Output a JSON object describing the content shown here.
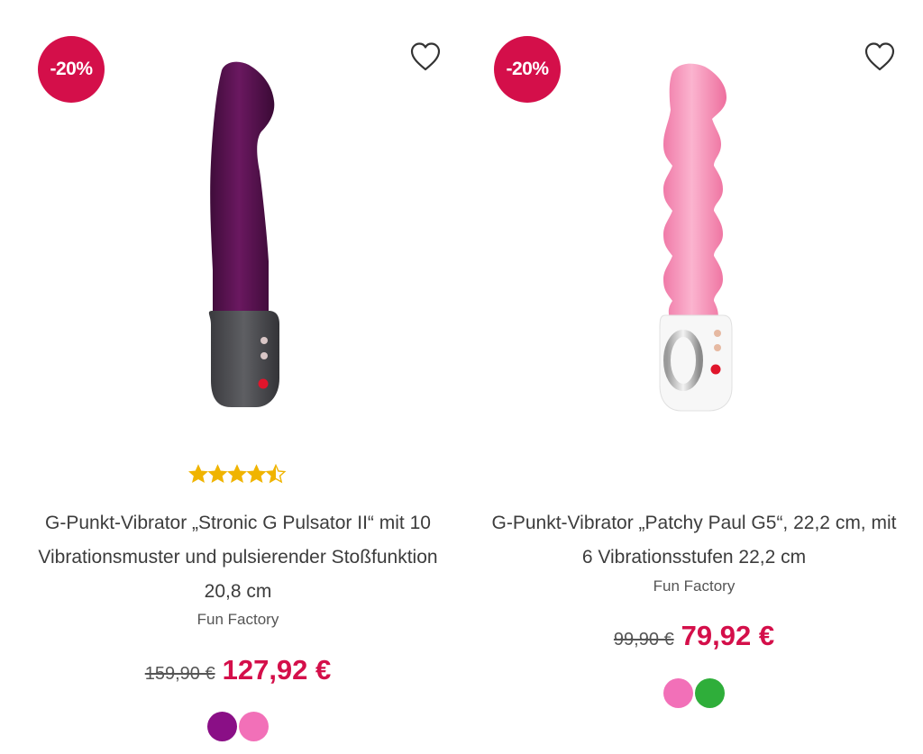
{
  "products": [
    {
      "discount": "-20%",
      "rating": 4.5,
      "title": "G-Punkt-Vibrator „Stronic G Pulsator II“ mit 10 Vibrationsmuster und pulsierender Stoßfunktion 20,8 cm",
      "brand": "Fun Factory",
      "old_price": "159,90 €",
      "new_price": "127,92 €",
      "swatches": [
        "#8a0f86",
        "#f270b8"
      ]
    },
    {
      "discount": "-20%",
      "title": "G-Punkt-Vibrator „Patchy Paul G5“, 22,2 cm, mit 6 Vibrationsstufen 22,2 cm",
      "brand": "Fun Factory",
      "old_price": "99,90 €",
      "new_price": "79,92 €",
      "swatches": [
        "#f270b8",
        "#2fae3a"
      ]
    }
  ],
  "colors": {
    "accent": "#d40f4a",
    "star": "#f0b400"
  }
}
